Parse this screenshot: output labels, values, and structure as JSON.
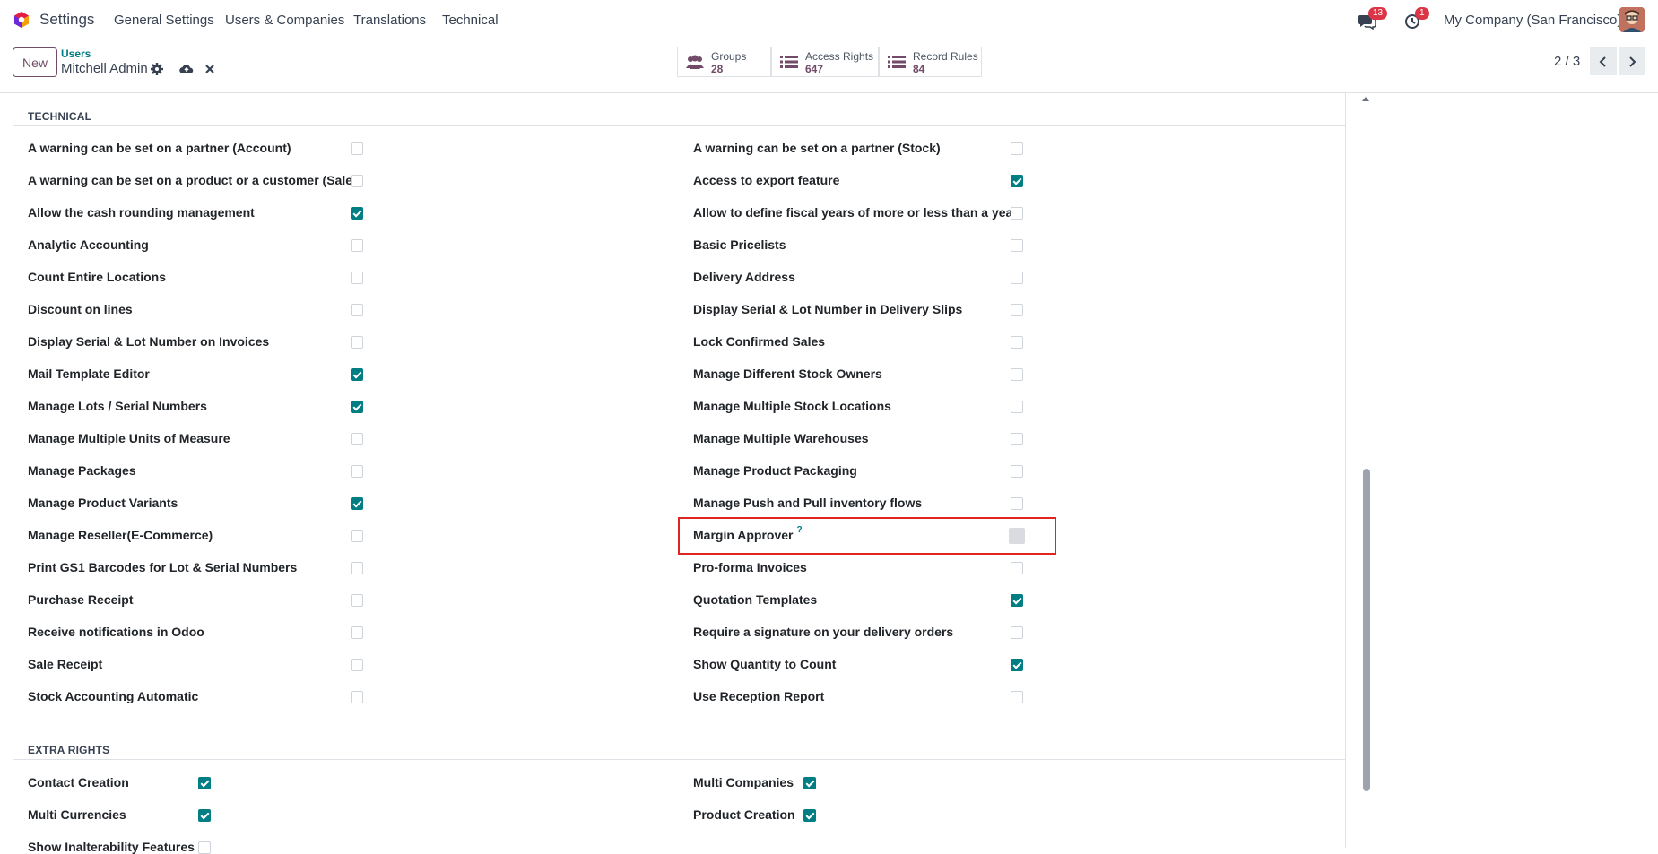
{
  "navbar": {
    "app_name": "Settings",
    "menus": [
      "General Settings",
      "Users & Companies",
      "Translations",
      "Technical"
    ],
    "messages_badge": "13",
    "activities_badge": "1",
    "company": "My Company (San Francisco)"
  },
  "control": {
    "new_label": "New",
    "breadcrumb_parent": "Users",
    "breadcrumb_current": "Mitchell Admin",
    "stats": [
      {
        "label": "Groups",
        "value": "28",
        "icon": "users-icon"
      },
      {
        "label": "Access Rights",
        "value": "647",
        "icon": "list-icon"
      },
      {
        "label": "Record Rules",
        "value": "84",
        "icon": "list-icon"
      }
    ],
    "pager": "2 / 3"
  },
  "technical": {
    "title": "TECHNICAL",
    "left": [
      {
        "label": "A warning can be set on a partner (Account)",
        "checked": false
      },
      {
        "label": "A warning can be set on a product or a customer (Sale)",
        "checked": false
      },
      {
        "label": "Allow the cash rounding management",
        "checked": true
      },
      {
        "label": "Analytic Accounting",
        "checked": false
      },
      {
        "label": "Count Entire Locations",
        "checked": false
      },
      {
        "label": "Discount on lines",
        "checked": false
      },
      {
        "label": "Display Serial & Lot Number on Invoices",
        "checked": false
      },
      {
        "label": "Mail Template Editor",
        "checked": true
      },
      {
        "label": "Manage Lots / Serial Numbers",
        "checked": true
      },
      {
        "label": "Manage Multiple Units of Measure",
        "checked": false
      },
      {
        "label": "Manage Packages",
        "checked": false
      },
      {
        "label": "Manage Product Variants",
        "checked": true
      },
      {
        "label": "Manage Reseller(E-Commerce)",
        "checked": false
      },
      {
        "label": "Print GS1 Barcodes for Lot & Serial Numbers",
        "checked": false
      },
      {
        "label": "Purchase Receipt",
        "checked": false
      },
      {
        "label": "Receive notifications in Odoo",
        "checked": false
      },
      {
        "label": "Sale Receipt",
        "checked": false
      },
      {
        "label": "Stock Accounting Automatic",
        "checked": false
      }
    ],
    "right": [
      {
        "label": "A warning can be set on a partner (Stock)",
        "checked": false
      },
      {
        "label": "Access to export feature",
        "checked": true
      },
      {
        "label": "Allow to define fiscal years of more or less than a year",
        "checked": false
      },
      {
        "label": "Basic Pricelists",
        "checked": false
      },
      {
        "label": "Delivery Address",
        "checked": false
      },
      {
        "label": "Display Serial & Lot Number in Delivery Slips",
        "checked": false
      },
      {
        "label": "Lock Confirmed Sales",
        "checked": false
      },
      {
        "label": "Manage Different Stock Owners",
        "checked": false
      },
      {
        "label": "Manage Multiple Stock Locations",
        "checked": false
      },
      {
        "label": "Manage Multiple Warehouses",
        "checked": false
      },
      {
        "label": "Manage Product Packaging",
        "checked": false
      },
      {
        "label": "Manage Push and Pull inventory flows",
        "checked": false
      },
      {
        "label": "Margin Approver",
        "checked": true,
        "help": "?"
      },
      {
        "label": "Pro-forma Invoices",
        "checked": false
      },
      {
        "label": "Quotation Templates",
        "checked": true
      },
      {
        "label": "Require a signature on your delivery orders",
        "checked": false
      },
      {
        "label": "Show Quantity to Count",
        "checked": true
      },
      {
        "label": "Use Reception Report",
        "checked": false
      }
    ]
  },
  "extra_rights": {
    "title": "EXTRA RIGHTS",
    "left": [
      {
        "label": "Contact Creation",
        "checked": true
      },
      {
        "label": "Multi Currencies",
        "checked": true
      },
      {
        "label": "Show Inalterability Features",
        "checked": false
      }
    ],
    "right": [
      {
        "label": "Multi Companies",
        "checked": true
      },
      {
        "label": "Product Creation",
        "checked": true
      }
    ]
  },
  "colors": {
    "accent": "#017e84",
    "brand": "#714b67",
    "highlight": "#e02424"
  }
}
